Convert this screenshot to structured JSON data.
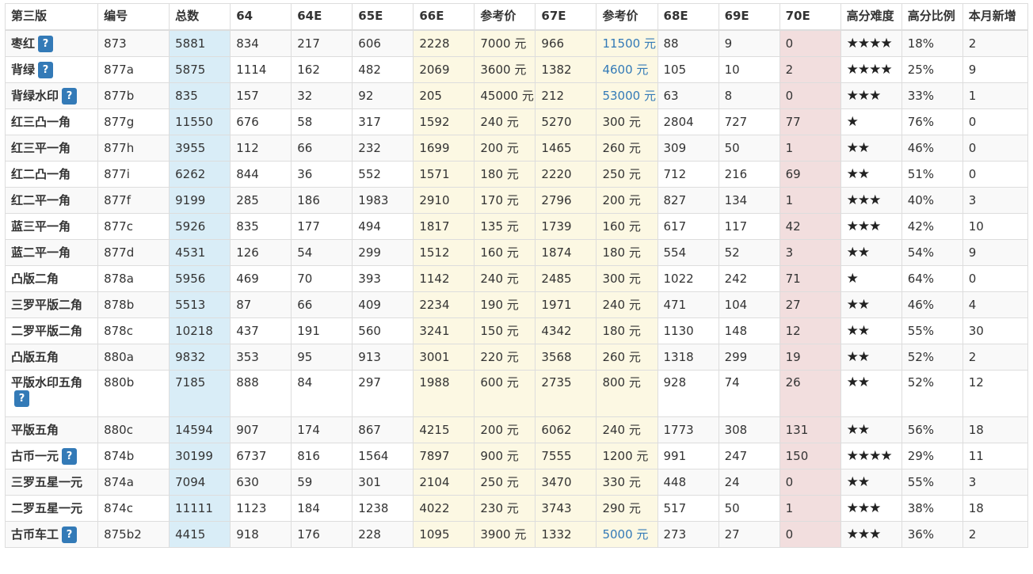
{
  "headers": [
    "第三版",
    "编号",
    "总数",
    "64",
    "64E",
    "65E",
    "66E",
    "参考价",
    "67E",
    "参考价",
    "68E",
    "69E",
    "70E",
    "高分难度",
    "高分比例",
    "本月新增"
  ],
  "rows": [
    {
      "name": "枣红",
      "help": true,
      "code": "873",
      "total": "5881",
      "c64": "834",
      "c64e": "217",
      "c65e": "606",
      "c66e": "2228",
      "p1": "7000 元",
      "c67e": "966",
      "p2": "11500 元",
      "p2link": true,
      "c68e": "88",
      "c69e": "9",
      "c70e": "0",
      "stars": "★★★★",
      "ratio": "18%",
      "new": "2"
    },
    {
      "name": "背绿",
      "help": true,
      "code": "877a",
      "total": "5875",
      "c64": "1114",
      "c64e": "162",
      "c65e": "482",
      "c66e": "2069",
      "p1": "3600 元",
      "c67e": "1382",
      "p2": "4600 元",
      "p2link": true,
      "c68e": "105",
      "c69e": "10",
      "c70e": "2",
      "stars": "★★★★",
      "ratio": "25%",
      "new": "9"
    },
    {
      "name": "背绿水印",
      "help": true,
      "code": "877b",
      "total": "835",
      "c64": "157",
      "c64e": "32",
      "c65e": "92",
      "c66e": "205",
      "p1": "45000 元",
      "c67e": "212",
      "p2": "53000 元",
      "p2link": true,
      "c68e": "63",
      "c69e": "8",
      "c70e": "0",
      "stars": "★★★",
      "ratio": "33%",
      "new": "1"
    },
    {
      "name": "红三凸一角",
      "help": false,
      "code": "877g",
      "total": "11550",
      "c64": "676",
      "c64e": "58",
      "c65e": "317",
      "c66e": "1592",
      "p1": "240 元",
      "c67e": "5270",
      "p2": "300 元",
      "p2link": false,
      "c68e": "2804",
      "c69e": "727",
      "c70e": "77",
      "stars": "★",
      "ratio": "76%",
      "new": "0"
    },
    {
      "name": "红三平一角",
      "help": false,
      "code": "877h",
      "total": "3955",
      "c64": "112",
      "c64e": "66",
      "c65e": "232",
      "c66e": "1699",
      "p1": "200 元",
      "c67e": "1465",
      "p2": "260 元",
      "p2link": false,
      "c68e": "309",
      "c69e": "50",
      "c70e": "1",
      "stars": "★★",
      "ratio": "46%",
      "new": "0"
    },
    {
      "name": "红二凸一角",
      "help": false,
      "code": "877i",
      "total": "6262",
      "c64": "844",
      "c64e": "36",
      "c65e": "552",
      "c66e": "1571",
      "p1": "180 元",
      "c67e": "2220",
      "p2": "250 元",
      "p2link": false,
      "c68e": "712",
      "c69e": "216",
      "c70e": "69",
      "stars": "★★",
      "ratio": "51%",
      "new": "0"
    },
    {
      "name": "红二平一角",
      "help": false,
      "code": "877f",
      "total": "9199",
      "c64": "285",
      "c64e": "186",
      "c65e": "1983",
      "c66e": "2910",
      "p1": "170 元",
      "c67e": "2796",
      "p2": "200 元",
      "p2link": false,
      "c68e": "827",
      "c69e": "134",
      "c70e": "1",
      "stars": "★★★",
      "ratio": "40%",
      "new": "3"
    },
    {
      "name": "蓝三平一角",
      "help": false,
      "code": "877c",
      "total": "5926",
      "c64": "835",
      "c64e": "177",
      "c65e": "494",
      "c66e": "1817",
      "p1": "135 元",
      "c67e": "1739",
      "p2": "160 元",
      "p2link": false,
      "c68e": "617",
      "c69e": "117",
      "c70e": "42",
      "stars": "★★★",
      "ratio": "42%",
      "new": "10"
    },
    {
      "name": "蓝二平一角",
      "help": false,
      "code": "877d",
      "total": "4531",
      "c64": "126",
      "c64e": "54",
      "c65e": "299",
      "c66e": "1512",
      "p1": "160 元",
      "c67e": "1874",
      "p2": "180 元",
      "p2link": false,
      "c68e": "554",
      "c69e": "52",
      "c70e": "3",
      "stars": "★★",
      "ratio": "54%",
      "new": "9"
    },
    {
      "name": "凸版二角",
      "help": false,
      "code": "878a",
      "total": "5956",
      "c64": "469",
      "c64e": "70",
      "c65e": "393",
      "c66e": "1142",
      "p1": "240 元",
      "c67e": "2485",
      "p2": "300 元",
      "p2link": false,
      "c68e": "1022",
      "c69e": "242",
      "c70e": "71",
      "stars": "★",
      "ratio": "64%",
      "new": "0"
    },
    {
      "name": "三罗平版二角",
      "help": false,
      "code": "878b",
      "total": "5513",
      "c64": "87",
      "c64e": "66",
      "c65e": "409",
      "c66e": "2234",
      "p1": "190 元",
      "c67e": "1971",
      "p2": "240 元",
      "p2link": false,
      "c68e": "471",
      "c69e": "104",
      "c70e": "27",
      "stars": "★★",
      "ratio": "46%",
      "new": "4"
    },
    {
      "name": "二罗平版二角",
      "help": false,
      "code": "878c",
      "total": "10218",
      "c64": "437",
      "c64e": "191",
      "c65e": "560",
      "c66e": "3241",
      "p1": "150 元",
      "c67e": "4342",
      "p2": "180 元",
      "p2link": false,
      "c68e": "1130",
      "c69e": "148",
      "c70e": "12",
      "stars": "★★",
      "ratio": "55%",
      "new": "30"
    },
    {
      "name": "凸版五角",
      "help": false,
      "code": "880a",
      "total": "9832",
      "c64": "353",
      "c64e": "95",
      "c65e": "913",
      "c66e": "3001",
      "p1": "220 元",
      "c67e": "3568",
      "p2": "260 元",
      "p2link": false,
      "c68e": "1318",
      "c69e": "299",
      "c70e": "19",
      "stars": "★★",
      "ratio": "52%",
      "new": "2"
    },
    {
      "name": "平版水印五角",
      "help": true,
      "tall": true,
      "code": "880b",
      "total": "7185",
      "c64": "888",
      "c64e": "84",
      "c65e": "297",
      "c66e": "1988",
      "p1": "600 元",
      "c67e": "2735",
      "p2": "800 元",
      "p2link": false,
      "c68e": "928",
      "c69e": "74",
      "c70e": "26",
      "stars": "★★",
      "ratio": "52%",
      "new": "12"
    },
    {
      "name": "平版五角",
      "help": false,
      "code": "880c",
      "total": "14594",
      "c64": "907",
      "c64e": "174",
      "c65e": "867",
      "c66e": "4215",
      "p1": "200 元",
      "c67e": "6062",
      "p2": "240 元",
      "p2link": false,
      "c68e": "1773",
      "c69e": "308",
      "c70e": "131",
      "stars": "★★",
      "ratio": "56%",
      "new": "18"
    },
    {
      "name": "古币一元",
      "help": true,
      "code": "874b",
      "total": "30199",
      "c64": "6737",
      "c64e": "816",
      "c65e": "1564",
      "c66e": "7897",
      "p1": "900 元",
      "c67e": "7555",
      "p2": "1200 元",
      "p2link": false,
      "c68e": "991",
      "c69e": "247",
      "c70e": "150",
      "stars": "★★★★",
      "ratio": "29%",
      "new": "11"
    },
    {
      "name": "三罗五星一元",
      "help": false,
      "code": "874a",
      "total": "7094",
      "c64": "630",
      "c64e": "59",
      "c65e": "301",
      "c66e": "2104",
      "p1": "250 元",
      "c67e": "3470",
      "p2": "330 元",
      "p2link": false,
      "c68e": "448",
      "c69e": "24",
      "c70e": "0",
      "stars": "★★",
      "ratio": "55%",
      "new": "3"
    },
    {
      "name": "二罗五星一元",
      "help": false,
      "code": "874c",
      "total": "11111",
      "c64": "1123",
      "c64e": "184",
      "c65e": "1238",
      "c66e": "4022",
      "p1": "230 元",
      "c67e": "3743",
      "p2": "290 元",
      "p2link": false,
      "c68e": "517",
      "c69e": "50",
      "c70e": "1",
      "stars": "★★★",
      "ratio": "38%",
      "new": "18"
    },
    {
      "name": "古币车工",
      "help": true,
      "code": "875b2",
      "total": "4415",
      "c64": "918",
      "c64e": "176",
      "c65e": "228",
      "c66e": "1095",
      "p1": "3900 元",
      "c67e": "1332",
      "p2": "5000 元",
      "p2link": true,
      "c68e": "273",
      "c69e": "27",
      "c70e": "0",
      "stars": "★★★",
      "ratio": "36%",
      "new": "2"
    }
  ],
  "help_label": "?",
  "accent": "#337ab7"
}
